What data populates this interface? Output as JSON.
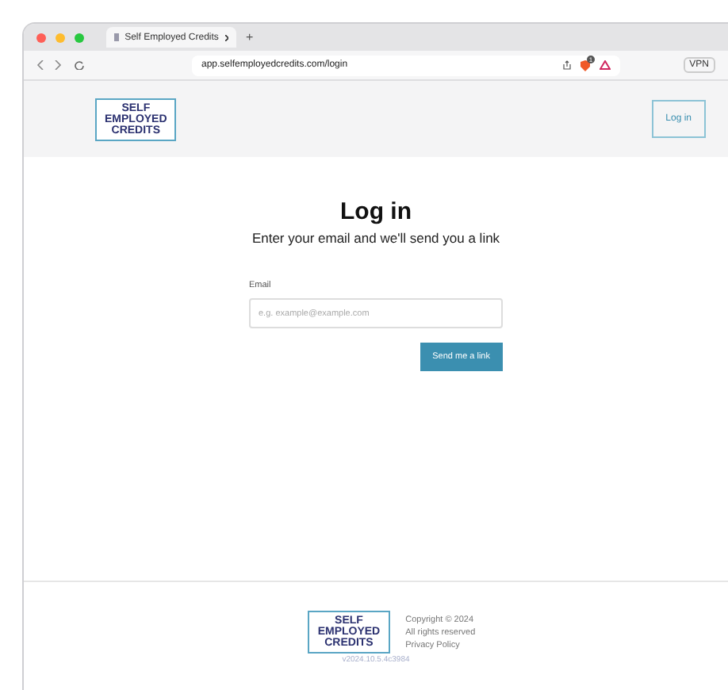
{
  "browser": {
    "tab_title": "Self Employed Credits",
    "new_tab": "+",
    "url": "app.selfemployedcredits.com/login",
    "vpn": "VPN",
    "shield_badge": "1"
  },
  "header": {
    "logo": [
      "SELF",
      "EMPLOYED",
      "CREDITS"
    ],
    "login_button": "Log in"
  },
  "main": {
    "title": "Log in",
    "subtitle": "Enter your email and we'll send you a link",
    "email_label": "Email",
    "email_placeholder": "e.g. example@example.com",
    "submit": "Send me a link"
  },
  "footer": {
    "logo": [
      "SELF",
      "EMPLOYED",
      "CREDITS"
    ],
    "copyright": "Copyright © 2024",
    "rights": "All rights reserved",
    "privacy": "Privacy Policy",
    "version": "v2024.10.5.4c3984"
  }
}
